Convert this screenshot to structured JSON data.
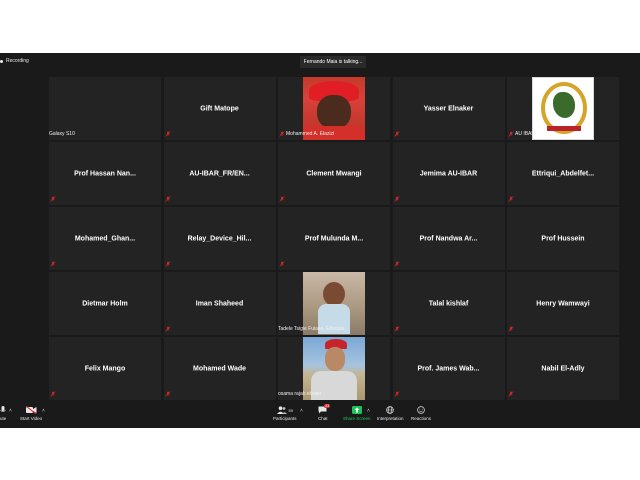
{
  "meeting": {
    "recording_label": "Recording",
    "talking_indicator": "Fernando Maia is talking..."
  },
  "tiles": [
    {
      "label": "Galaxy S10"
    },
    {
      "name": "Gift Matope"
    },
    {
      "label": "Mohammed A. Elazizi"
    },
    {
      "name": "Yasser Elnaker"
    },
    {
      "label": "AU IBAR"
    },
    {
      "name": "Prof Hassan Nan..."
    },
    {
      "name": "AU-IBAR_FR/EN..."
    },
    {
      "name": "Clement Mwangi"
    },
    {
      "name": "Jemima AU-IBAR"
    },
    {
      "name": "Ettriqui_Abdelfet..."
    },
    {
      "name": "Mohamed_Ghan..."
    },
    {
      "name": "Relay_Device_Hil..."
    },
    {
      "name": "Prof Mulunda M..."
    },
    {
      "name": "Prof Nandwa Ar..."
    },
    {
      "name": "Prof Hussein"
    },
    {
      "name": "Dietmar Holm"
    },
    {
      "name": "Iman Shaheed"
    },
    {
      "label": "Tadele Tsigie Fulasa, Ethiopia..."
    },
    {
      "name": "Talal kishlaf"
    },
    {
      "name": "Henry Wamwayi"
    },
    {
      "name": "Felix Mango"
    },
    {
      "name": "Mohamed Wade"
    },
    {
      "label": "osama rajab elwaer"
    },
    {
      "name": "Prof. James Wab..."
    },
    {
      "name": "Nabil El-Adly"
    }
  ],
  "toolbar": {
    "mute_label": "ute",
    "start_video_label": "Start Video",
    "participants_label": "Participants",
    "participants_count": "59",
    "chat_label": "Chat",
    "chat_badge": "23",
    "share_screen_label": "Share Screen",
    "interpretation_label": "Interpretation",
    "reactions_label": "Reactions"
  },
  "colors": {
    "background": "#1a1a1a",
    "tile": "#232323",
    "muted_icon": "#e02828",
    "share_screen": "#1fc25a"
  }
}
